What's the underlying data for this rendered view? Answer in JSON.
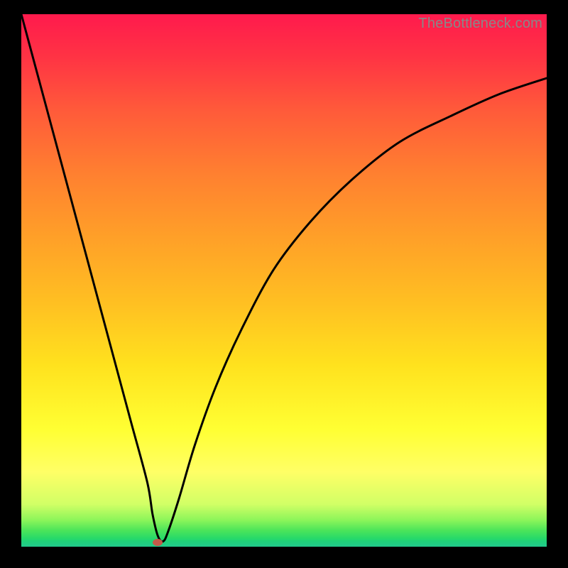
{
  "watermark": "TheBottleneck.com",
  "colors": {
    "top": "#ff1a4d",
    "mid1": "#ff8030",
    "mid2": "#ffe21e",
    "low": "#ffff66",
    "green": "#26d86a",
    "marker": "#c45a4a",
    "line": "#000000",
    "frame": "#000000"
  },
  "chart_data": {
    "type": "line",
    "title": "",
    "xlabel": "",
    "ylabel": "",
    "xlim": [
      0,
      100
    ],
    "ylim": [
      0,
      100
    ],
    "grid": false,
    "legend": false,
    "annotations": [
      "TheBottleneck.com"
    ],
    "notes": "Bottleneck-percentage style curve: steep near-linear descent from top-left to a near-zero minimum around x≈26, then a concave rise approaching ~88 at the right edge. Background is a vertical red→green gradient; a small red/brown marker sits at the minimum.",
    "series": [
      {
        "name": "curve",
        "x": [
          0,
          3,
          6,
          9,
          12,
          15,
          18,
          21,
          24,
          25,
          26,
          27,
          28,
          30,
          33,
          37,
          42,
          48,
          55,
          63,
          72,
          82,
          91,
          100
        ],
        "y": [
          100,
          89,
          78,
          67,
          56,
          45,
          34,
          23,
          12,
          6,
          2,
          1,
          3,
          9,
          19,
          30,
          41,
          52,
          61,
          69,
          76,
          81,
          85,
          88
        ]
      }
    ],
    "marker": {
      "x": 26,
      "y": 0.8
    }
  }
}
